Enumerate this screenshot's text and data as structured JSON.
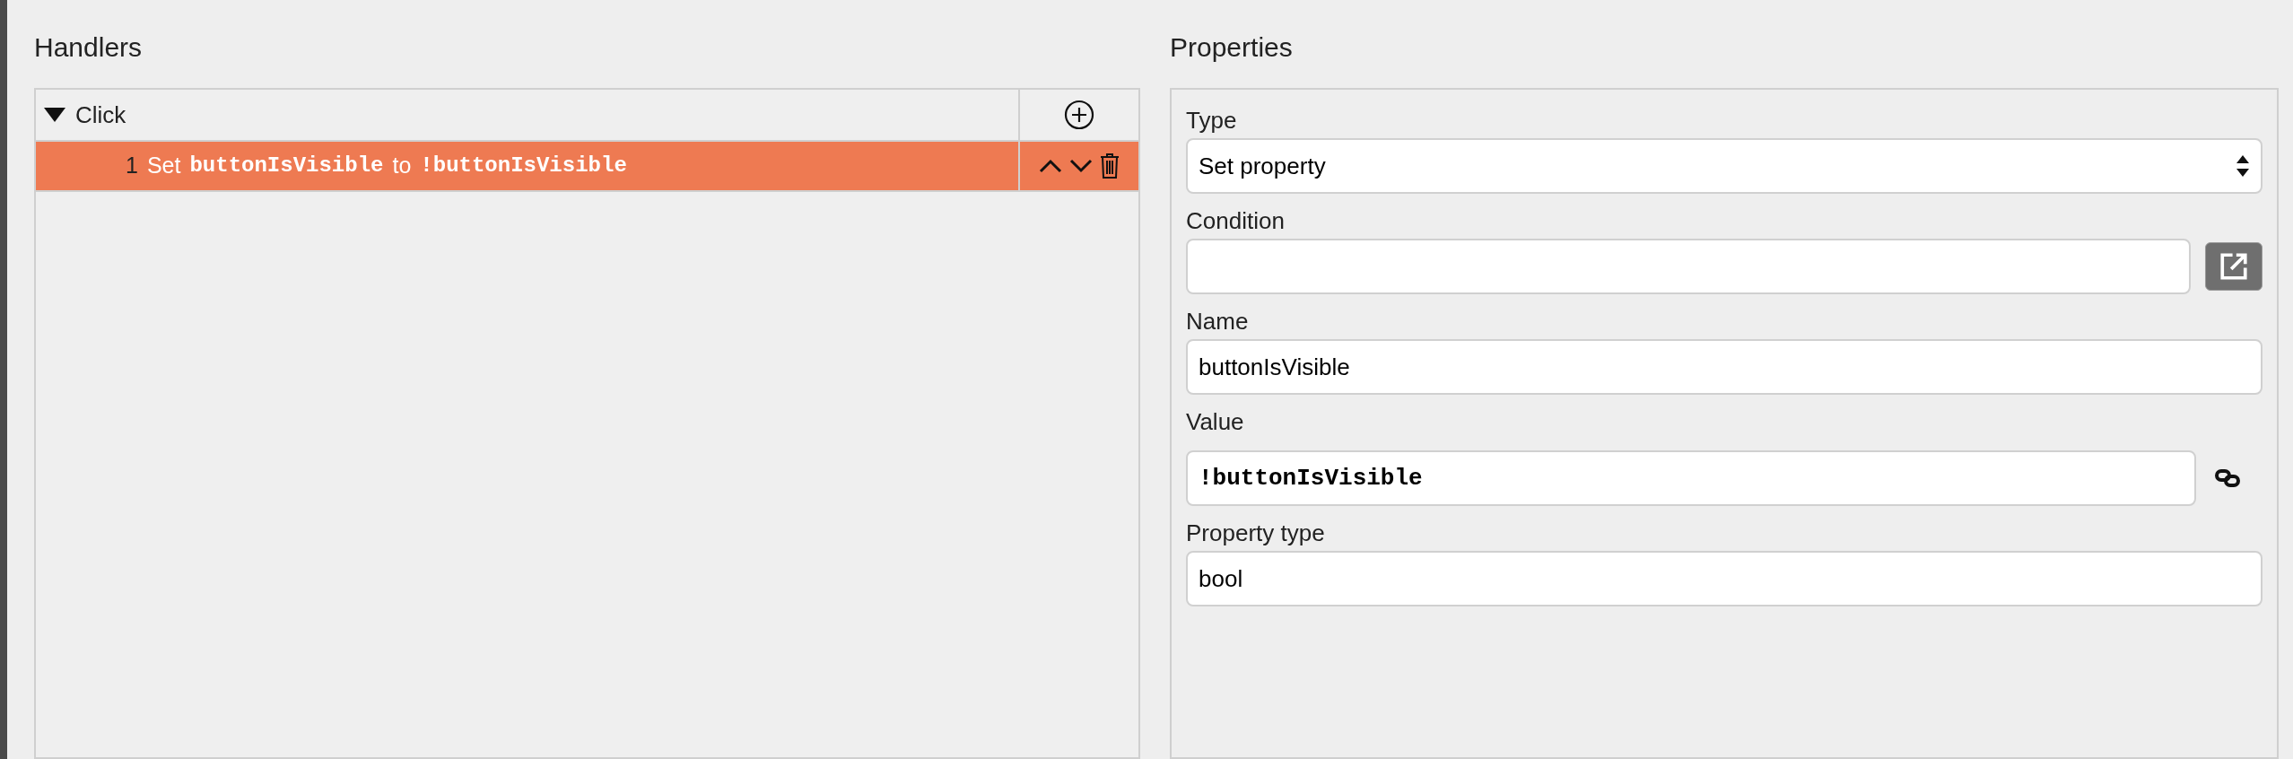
{
  "handlers": {
    "title": "Handlers",
    "events": [
      {
        "label": "Click",
        "expanded": true,
        "actions": [
          {
            "number": "1",
            "selected": true,
            "parts": [
              {
                "kind": "text",
                "text": "Set"
              },
              {
                "kind": "code",
                "text": "buttonIsVisible"
              },
              {
                "kind": "text",
                "text": "to"
              },
              {
                "kind": "code",
                "text": "!buttonIsVisible"
              }
            ]
          }
        ]
      }
    ]
  },
  "properties": {
    "title": "Properties",
    "fields": [
      {
        "kind": "select",
        "label": "Type",
        "value": "Set property"
      },
      {
        "kind": "expression",
        "label": "Condition"
      },
      {
        "kind": "text",
        "label": "Name",
        "value": "buttonIsVisible"
      },
      {
        "kind": "linked",
        "label": "Value",
        "value": "!buttonIsVisible"
      },
      {
        "kind": "text",
        "label": "Property type",
        "value": "bool"
      }
    ]
  }
}
